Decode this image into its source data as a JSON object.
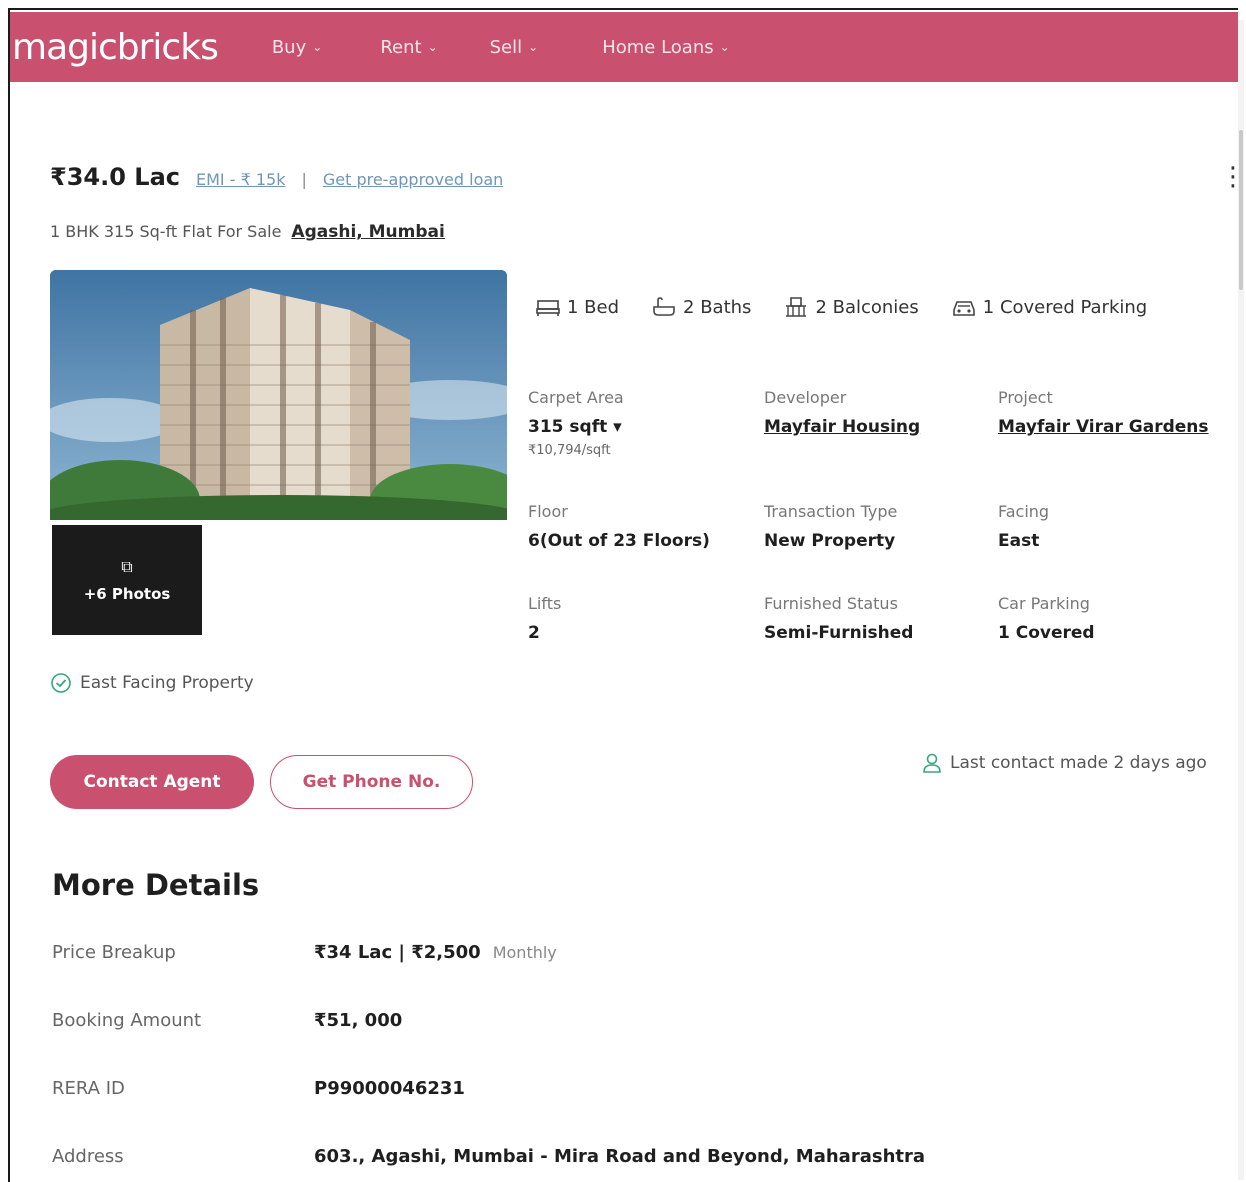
{
  "brand": {
    "logo": "magicbricks",
    "accent": "#c9506f"
  },
  "nav": {
    "buy": "Buy",
    "rent": "Rent",
    "sell": "Sell",
    "home_loans": "Home Loans"
  },
  "listing": {
    "price": "₹34.0 Lac",
    "emi": "EMI - ₹ 15k",
    "separator": "|",
    "loan_link": "Get pre-approved loan",
    "subtitle": "1 BHK 315 Sq-ft Flat For Sale",
    "location": "Agashi, Mumbai",
    "photos_label": "+6 Photos",
    "facing_note": "East Facing Property"
  },
  "amenities": {
    "bed": "1 Bed",
    "baths": "2 Baths",
    "balconies": "2 Balconies",
    "parking": "1 Covered Parking"
  },
  "specs": {
    "carpet_area": {
      "label": "Carpet Area",
      "value": "315 sqft ▾",
      "sub": "₹10,794/sqft"
    },
    "developer": {
      "label": "Developer",
      "value": "Mayfair Housing"
    },
    "project": {
      "label": "Project",
      "value": "Mayfair Virar Gardens"
    },
    "floor": {
      "label": "Floor",
      "value": "6(Out of 23 Floors)"
    },
    "transaction": {
      "label": "Transaction Type",
      "value": "New Property"
    },
    "facing": {
      "label": "Facing",
      "value": "East"
    },
    "lifts": {
      "label": "Lifts",
      "value": "2"
    },
    "furnished": {
      "label": "Furnished Status",
      "value": "Semi-Furnished"
    },
    "car_parking": {
      "label": "Car Parking",
      "value": "1 Covered"
    }
  },
  "actions": {
    "contact_agent": "Contact Agent",
    "get_phone": "Get Phone No.",
    "last_contact": "Last contact made 2 days ago"
  },
  "more_details": {
    "title": "More Details",
    "price_breakup": {
      "label": "Price Breakup",
      "value": "₹34 Lac | ₹2,500",
      "note": "Monthly"
    },
    "booking_amount": {
      "label": "Booking Amount",
      "value": "₹51, 000"
    },
    "rera_id": {
      "label": "RERA ID",
      "value": "P99000046231"
    },
    "address": {
      "label": "Address",
      "value": "603., Agashi, Mumbai - Mira Road and Beyond, Maharashtra"
    }
  }
}
